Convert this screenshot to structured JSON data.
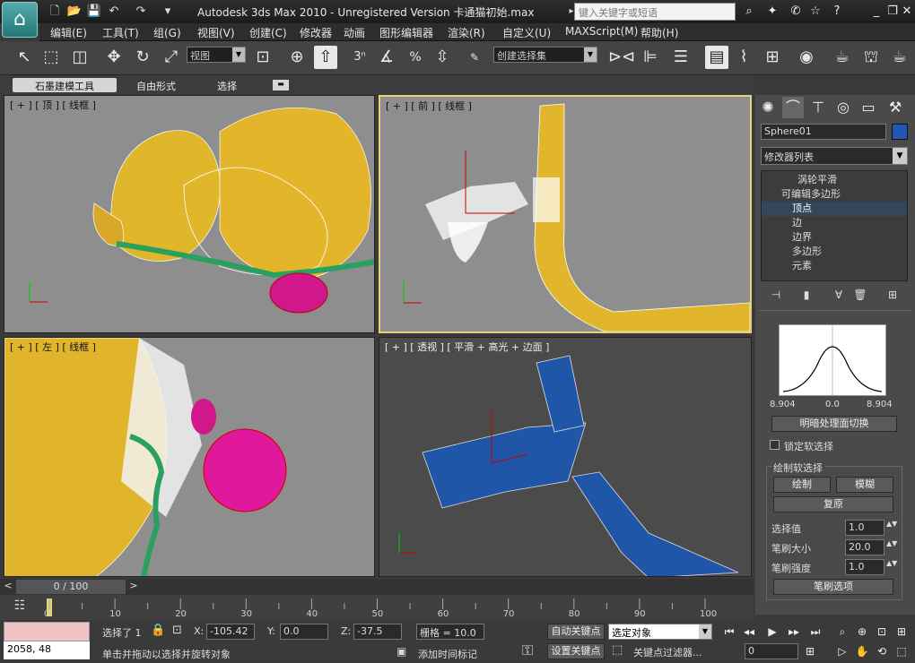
{
  "title": "Autodesk 3ds Max  2010  - Unregistered Version    卡通猫初始.max",
  "search_placeholder": "键入关键字或短语",
  "menu": [
    "编辑(E)",
    "工具(T)",
    "组(G)",
    "视图(V)",
    "创建(C)",
    "修改器",
    "动画",
    "图形编辑器",
    "渲染(R)",
    "自定义(U)",
    "MAXScript(M)",
    "帮助(H)"
  ],
  "toolbar": {
    "view_dropdown": "视图",
    "selection_set": "创建选择集",
    "snap_3": "3",
    "snap_pct": "%"
  },
  "ribbon_tabs": [
    "石墨建模工具",
    "自由形式",
    "选择"
  ],
  "viewports": {
    "top": "[ + ] [ 顶 ] [ 线框 ]",
    "front": "[ + ] [ 前 ] [ 线框 ]",
    "left": "[ + ] [ 左 ] [ 线框 ]",
    "persp": "[ + ] [ 透视 ] [ 平滑 + 高光 + 边面 ]"
  },
  "command_panel": {
    "object_name": "Sphere01",
    "object_color": "#2256b4",
    "modifier_list": "修改器列表",
    "stack": [
      "涡轮平滑",
      "可编辑多边形",
      "顶点",
      "边",
      "边界",
      "多边形",
      "元素"
    ],
    "curve_labels": [
      "8.904",
      "0.0",
      "8.904"
    ],
    "shaded_toggle": "明暗处理面切换",
    "lock_soft_sel": "锁定软选择",
    "paint_group": "绘制软选择",
    "paint": "绘制",
    "blur": "模糊",
    "revert": "复原",
    "select_value_label": "选择值",
    "select_value": "1.0",
    "brush_size_label": "笔刷大小",
    "brush_size": "20.0",
    "brush_strength_label": "笔刷强度",
    "brush_strength": "1.0",
    "brush_options": "笔刷选项"
  },
  "timeline": {
    "slider": "0 / 100",
    "ticks": [
      "0",
      "10",
      "20",
      "30",
      "40",
      "50",
      "60",
      "70",
      "80",
      "90",
      "100"
    ],
    "frame": 0,
    "frame_total": 100
  },
  "status": {
    "selection_status": "选择了 1",
    "x_label": "X:",
    "x_value": "-105.42",
    "y_label": "Y:",
    "y_value": "0.0",
    "z_label": "Z:",
    "z_value": "-37.5",
    "grid": "栅格 = 10.0",
    "auto_key": "自动关键点",
    "set_key": "设置关键点",
    "key_target": "选定对象",
    "key_filters": "关键点过滤器...",
    "add_time_tag": "添加时间标记",
    "prompt": "单击并拖动以选择并旋转对象",
    "coords_readout": "2058, 48",
    "frame_field": "0",
    "maxscript_field": ""
  },
  "accent": "#e3d27a"
}
